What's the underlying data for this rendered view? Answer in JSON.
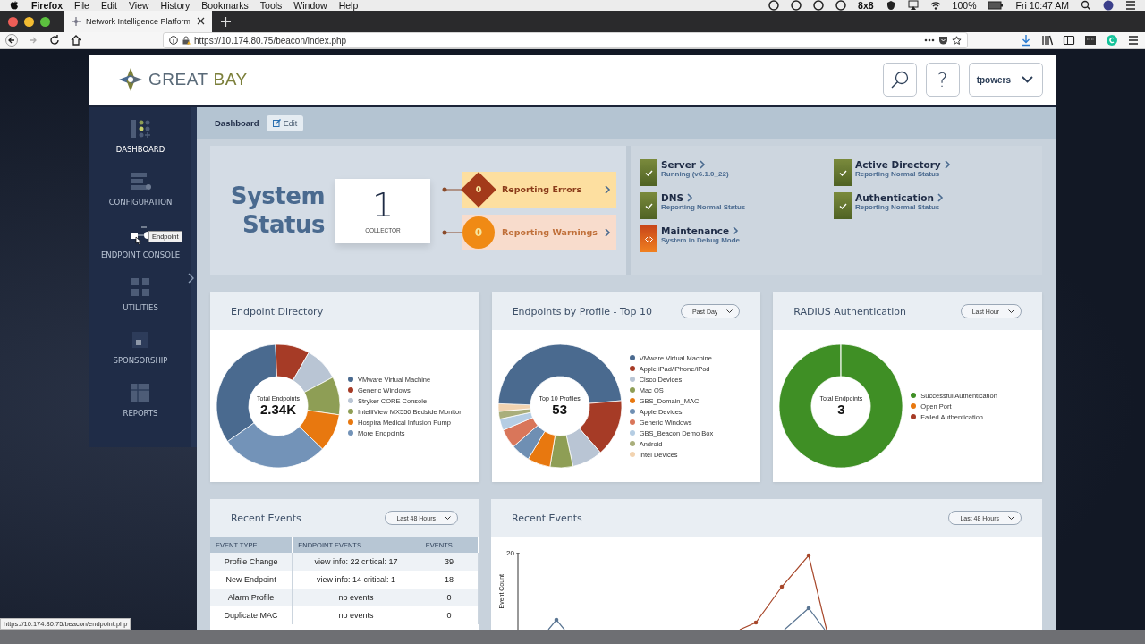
{
  "menubar": {
    "app": "Firefox",
    "menus": [
      "File",
      "Edit",
      "View",
      "History",
      "Bookmarks",
      "Tools",
      "Window",
      "Help"
    ],
    "status_text": "8x8",
    "battery": "100%",
    "clock": "Fri 10:47 AM"
  },
  "browser": {
    "tab_title": "Network Intelligence Platform",
    "forward_disabled": true,
    "url": "https://10.174.80.75/beacon/index.php",
    "status_url": "https://10.174.80.75/beacon/endpoint.php"
  },
  "header": {
    "logo": [
      "GREAT",
      "BAY"
    ],
    "help": "?",
    "user": "tpowers"
  },
  "sidebar": {
    "items": [
      {
        "label": "DASHBOARD",
        "selected": true
      },
      {
        "label": "CONFIGURATION",
        "selected": false
      },
      {
        "label": "ENDPOINT CONSOLE",
        "selected": false
      },
      {
        "label": "UTILITIES",
        "selected": false
      },
      {
        "label": "SPONSORSHIP",
        "selected": false
      },
      {
        "label": "REPORTS",
        "selected": false
      }
    ],
    "tooltip": "Endpoint"
  },
  "breadcrumb": {
    "title": "Dashboard",
    "edit": "Edit"
  },
  "system_status": {
    "title": "System Status",
    "collector_count": "1",
    "collector_label": "COLLECTOR",
    "alerts": [
      {
        "kind": "error",
        "count": "0",
        "label": "Reporting Errors"
      },
      {
        "kind": "warning",
        "count": "0",
        "label": "Reporting Warnings"
      }
    ],
    "services": [
      {
        "name": "Server",
        "detail": "Running (v6.1.0_22)",
        "kind": "ok"
      },
      {
        "name": "Active Directory",
        "detail": "Reporting Normal Status",
        "kind": "ok"
      },
      {
        "name": "DNS",
        "detail": "Reporting Normal Status",
        "kind": "ok"
      },
      {
        "name": "Authentication",
        "detail": "Reporting Normal Status",
        "kind": "ok"
      },
      {
        "name": "Maintenance",
        "detail": "System in Debug Mode",
        "kind": "debug"
      }
    ]
  },
  "cards": [
    {
      "title": "Endpoint Directory",
      "center_label": "Total Endpoints",
      "center_value": "2.34K",
      "legend": [
        {
          "label": "VMware Virtual Machine",
          "color": "#4a6a8f"
        },
        {
          "label": "Generic Windows",
          "color": "#a63b26"
        },
        {
          "label": "Stryker CORE Console",
          "color": "#b9c5d4"
        },
        {
          "label": "IntelliView MX550 Bedside Monitor",
          "color": "#8e9e55"
        },
        {
          "label": "Hospira Medical Infusion Pump",
          "color": "#e8780f"
        },
        {
          "label": "More Endpoints",
          "color": "#7393b8"
        }
      ]
    },
    {
      "title": "Endpoints by Profile - Top 10",
      "range": "Past Day",
      "center_label": "Top 10 Profiles",
      "center_value": "53",
      "legend": [
        {
          "label": "VMware Virtual Machine",
          "color": "#4a6a8f"
        },
        {
          "label": "Apple iPad/iPhone/iPod",
          "color": "#a63b26"
        },
        {
          "label": "Cisco Devices",
          "color": "#b9c5d4"
        },
        {
          "label": "Mac OS",
          "color": "#8e9e55"
        },
        {
          "label": "GBS_Domain_MAC",
          "color": "#e8780f"
        },
        {
          "label": "Apple Devices",
          "color": "#6f8fb3"
        },
        {
          "label": "Generic Windows",
          "color": "#d9765a"
        },
        {
          "label": "GBS_Beacon Demo Box",
          "color": "#b5cde3"
        },
        {
          "label": "Android",
          "color": "#a9ae7b"
        },
        {
          "label": "Intel Devices",
          "color": "#f2d3b0"
        }
      ]
    },
    {
      "title": "RADIUS Authentication",
      "range": "Last Hour",
      "center_label": "Total Endpoints",
      "center_value": "3",
      "legend": [
        {
          "label": "Successful Authentication",
          "color": "#3f8f25"
        },
        {
          "label": "Open Port",
          "color": "#e8780f"
        },
        {
          "label": "Failed Authentication",
          "color": "#a63b26"
        }
      ]
    }
  ],
  "events_table": {
    "title": "Recent Events",
    "range": "Last 48 Hours",
    "columns": [
      "EVENT TYPE",
      "ENDPOINT EVENTS",
      "EVENTS"
    ],
    "rows": [
      [
        "Profile Change",
        "view info: 22 critical: 17",
        "39"
      ],
      [
        "New Endpoint",
        "view info: 14 critical: 1",
        "18"
      ],
      [
        "Alarm Profile",
        "no events",
        "0"
      ],
      [
        "Duplicate MAC",
        "no events",
        "0"
      ]
    ]
  },
  "events_chart": {
    "title": "Recent Events",
    "range": "Last 48 Hours",
    "y_tick": "20",
    "y_label": "Event Count"
  }
}
